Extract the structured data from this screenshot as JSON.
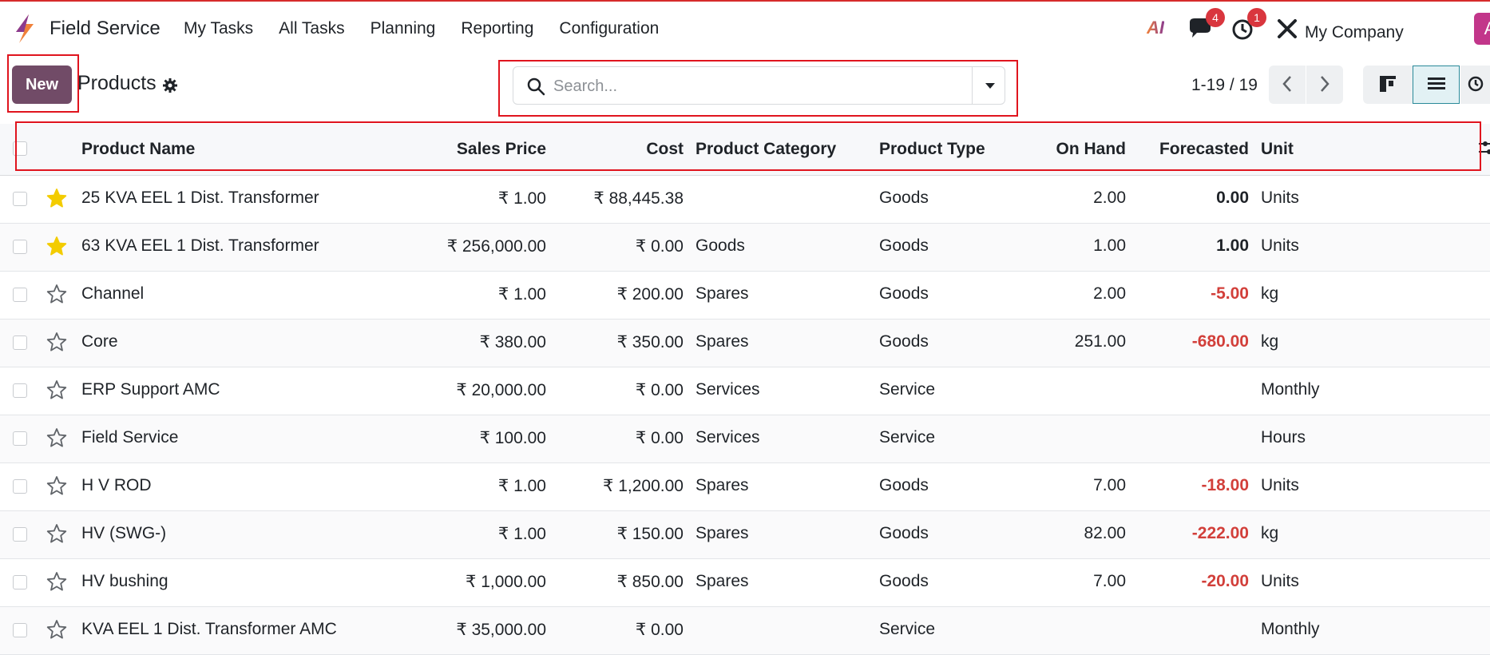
{
  "navbar": {
    "app_name": "Field Service",
    "menu": [
      "My Tasks",
      "All Tasks",
      "Planning",
      "Reporting",
      "Configuration"
    ],
    "ai_label": "AI",
    "messages_badge": "4",
    "activity_badge": "1",
    "company": "My Company",
    "user_initial": "A"
  },
  "control": {
    "new_label": "New",
    "breadcrumb": "Products",
    "search_placeholder": "Search...",
    "pager": "1-19 / 19"
  },
  "columns": {
    "name": "Product Name",
    "sales_price": "Sales Price",
    "cost": "Cost",
    "category": "Product Category",
    "type": "Product Type",
    "on_hand": "On Hand",
    "forecasted": "Forecasted",
    "unit": "Unit"
  },
  "rows": [
    {
      "starred": true,
      "name": "25 KVA EEL 1 Dist. Transformer",
      "sales_price": "₹ 1.00",
      "cost": "₹ 88,445.38",
      "category": "",
      "type": "Goods",
      "on_hand": "2.00",
      "forecasted": "0.00",
      "forecast_negative": false,
      "unit": "Units"
    },
    {
      "starred": true,
      "name": "63 KVA EEL 1 Dist. Transformer",
      "sales_price": "₹ 256,000.00",
      "cost": "₹ 0.00",
      "category": "Goods",
      "type": "Goods",
      "on_hand": "1.00",
      "forecasted": "1.00",
      "forecast_negative": false,
      "unit": "Units"
    },
    {
      "starred": false,
      "name": "Channel",
      "sales_price": "₹ 1.00",
      "cost": "₹ 200.00",
      "category": "Spares",
      "type": "Goods",
      "on_hand": "2.00",
      "forecasted": "-5.00",
      "forecast_negative": true,
      "unit": "kg"
    },
    {
      "starred": false,
      "name": "Core",
      "sales_price": "₹ 380.00",
      "cost": "₹ 350.00",
      "category": "Spares",
      "type": "Goods",
      "on_hand": "251.00",
      "forecasted": "-680.00",
      "forecast_negative": true,
      "unit": "kg"
    },
    {
      "starred": false,
      "name": "ERP Support AMC",
      "sales_price": "₹ 20,000.00",
      "cost": "₹ 0.00",
      "category": "Services",
      "type": "Service",
      "on_hand": "",
      "forecasted": "",
      "forecast_negative": false,
      "unit": "Monthly"
    },
    {
      "starred": false,
      "name": "Field Service",
      "sales_price": "₹ 100.00",
      "cost": "₹ 0.00",
      "category": "Services",
      "type": "Service",
      "on_hand": "",
      "forecasted": "",
      "forecast_negative": false,
      "unit": "Hours"
    },
    {
      "starred": false,
      "name": "H V ROD",
      "sales_price": "₹ 1.00",
      "cost": "₹ 1,200.00",
      "category": "Spares",
      "type": "Goods",
      "on_hand": "7.00",
      "forecasted": "-18.00",
      "forecast_negative": true,
      "unit": "Units"
    },
    {
      "starred": false,
      "name": "HV (SWG-)",
      "sales_price": "₹ 1.00",
      "cost": "₹ 150.00",
      "category": "Spares",
      "type": "Goods",
      "on_hand": "82.00",
      "forecasted": "-222.00",
      "forecast_negative": true,
      "unit": "kg"
    },
    {
      "starred": false,
      "name": "HV bushing",
      "sales_price": "₹ 1,000.00",
      "cost": "₹ 850.00",
      "category": "Spares",
      "type": "Goods",
      "on_hand": "7.00",
      "forecasted": "-20.00",
      "forecast_negative": true,
      "unit": "Units"
    },
    {
      "starred": false,
      "name": "KVA EEL 1 Dist. Transformer AMC",
      "sales_price": "₹ 35,000.00",
      "cost": "₹ 0.00",
      "category": "",
      "type": "Service",
      "on_hand": "",
      "forecasted": "",
      "forecast_negative": false,
      "unit": "Monthly"
    }
  ],
  "colors": {
    "primary": "#714b67",
    "highlight": "#e0141e",
    "negative": "#d23f3a",
    "star": "#f3cc00",
    "badge": "#d9363e"
  }
}
